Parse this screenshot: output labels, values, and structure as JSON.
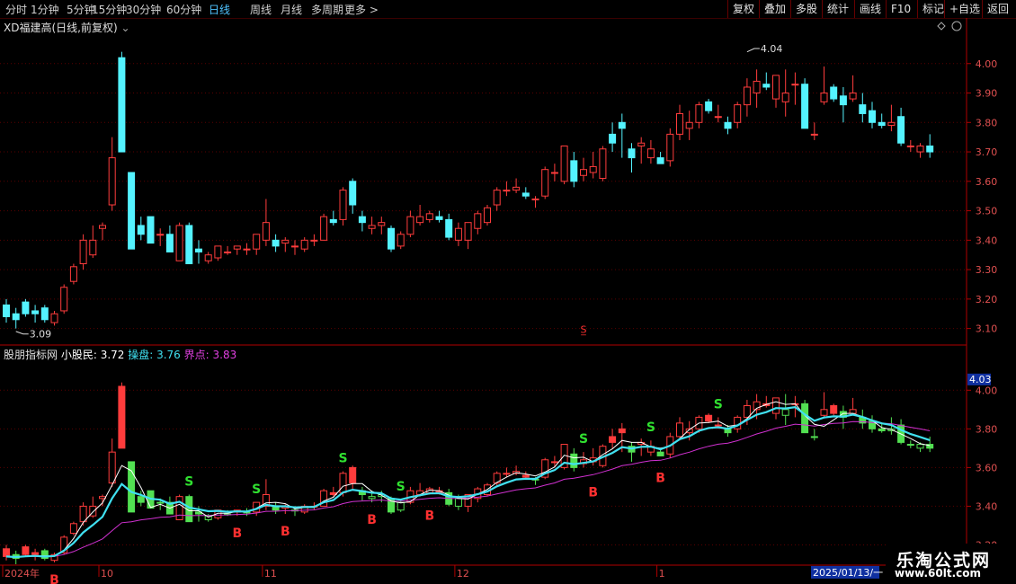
{
  "toolbar": {
    "periods": [
      "分时",
      "1分钟",
      "5分钟",
      "15分钟",
      "30分钟",
      "60分钟",
      "日线",
      "周线",
      "月线",
      "多周期",
      "更多 >"
    ],
    "active_period": "日线",
    "right_buttons": [
      "复权",
      "叠加",
      "多股",
      "统计",
      "画线",
      "F10",
      "标记",
      "+自选",
      "返回"
    ]
  },
  "main_title": "XD福建高(日线,前复权)",
  "indicator": {
    "name": "股朋指标网",
    "lines": [
      {
        "label": "小股民: 3.72",
        "color": "#ffffff"
      },
      {
        "label": "操盘: 3.76",
        "color": "#40e0f0"
      },
      {
        "label": "界点: 3.83",
        "color": "#e040e0"
      }
    ],
    "current_tag": "4.03"
  },
  "x_axis": {
    "labels": [
      {
        "text": "2024年",
        "index": 0
      },
      {
        "text": "10",
        "index": 10
      },
      {
        "text": "11",
        "index": 27
      },
      {
        "text": "12",
        "index": 47
      },
      {
        "text": "1",
        "index": 68
      }
    ],
    "cursor_date": "2025/01/13/一"
  },
  "brand": {
    "title": "乐淘公式网",
    "url": "www.60lt.com"
  },
  "colors": {
    "up": "#ff3c3c",
    "down": "#54f3ff",
    "grid": "#5a0000",
    "axis": "#b00000"
  },
  "chart_data": {
    "type": "candlestick",
    "y_ticks_main": [
      "4.00",
      "3.90",
      "3.80",
      "3.70",
      "3.60",
      "3.50",
      "3.40",
      "3.30",
      "3.20",
      "3.10"
    ],
    "y_ticks_sub": [
      "4.00",
      "3.80",
      "3.60",
      "3.40",
      "3.20"
    ],
    "ylim_main": [
      3.05,
      4.1
    ],
    "ylim_sub": [
      3.1,
      4.15
    ],
    "annotations": [
      {
        "text": "4.04",
        "index": 77,
        "value": 4.04
      },
      {
        "text": "3.09",
        "index": 1,
        "value": 3.09
      },
      {
        "text": "S̲",
        "index": 60,
        "value": 3.085
      }
    ],
    "ohlc": [
      [
        3.18,
        3.2,
        3.12,
        3.14
      ],
      [
        3.15,
        3.17,
        3.1,
        3.13
      ],
      [
        3.19,
        3.2,
        3.14,
        3.15
      ],
      [
        3.16,
        3.18,
        3.12,
        3.15
      ],
      [
        3.17,
        3.18,
        3.12,
        3.13
      ],
      [
        3.12,
        3.16,
        3.11,
        3.15
      ],
      [
        3.16,
        3.25,
        3.15,
        3.24
      ],
      [
        3.26,
        3.32,
        3.25,
        3.31
      ],
      [
        3.32,
        3.42,
        3.3,
        3.4
      ],
      [
        3.35,
        3.45,
        3.34,
        3.4
      ],
      [
        3.44,
        3.46,
        3.4,
        3.45
      ],
      [
        3.52,
        3.75,
        3.5,
        3.68
      ],
      [
        4.02,
        4.04,
        3.75,
        3.7
      ],
      [
        3.63,
        3.63,
        3.37,
        3.37
      ],
      [
        3.45,
        3.48,
        3.4,
        3.42
      ],
      [
        3.48,
        3.48,
        3.4,
        3.39
      ],
      [
        3.42,
        3.44,
        3.38,
        3.42
      ],
      [
        3.42,
        3.45,
        3.36,
        3.36
      ],
      [
        3.33,
        3.46,
        3.33,
        3.45
      ],
      [
        3.45,
        3.46,
        3.32,
        3.32
      ],
      [
        3.37,
        3.4,
        3.32,
        3.36
      ],
      [
        3.33,
        3.36,
        3.32,
        3.35
      ],
      [
        3.34,
        3.38,
        3.33,
        3.38
      ],
      [
        3.36,
        3.38,
        3.35,
        3.36
      ],
      [
        3.37,
        3.38,
        3.35,
        3.38
      ],
      [
        3.37,
        3.39,
        3.35,
        3.37
      ],
      [
        3.37,
        3.42,
        3.35,
        3.42
      ],
      [
        3.4,
        3.54,
        3.38,
        3.46
      ],
      [
        3.4,
        3.42,
        3.36,
        3.38
      ],
      [
        3.39,
        3.41,
        3.36,
        3.4
      ],
      [
        3.38,
        3.4,
        3.35,
        3.38
      ],
      [
        3.37,
        3.41,
        3.36,
        3.4
      ],
      [
        3.4,
        3.42,
        3.38,
        3.4
      ],
      [
        3.4,
        3.49,
        3.4,
        3.48
      ],
      [
        3.47,
        3.5,
        3.45,
        3.46
      ],
      [
        3.47,
        3.58,
        3.45,
        3.57
      ],
      [
        3.6,
        3.61,
        3.49,
        3.52
      ],
      [
        3.48,
        3.5,
        3.43,
        3.46
      ],
      [
        3.44,
        3.48,
        3.42,
        3.45
      ],
      [
        3.45,
        3.48,
        3.42,
        3.46
      ],
      [
        3.44,
        3.45,
        3.36,
        3.37
      ],
      [
        3.38,
        3.43,
        3.37,
        3.42
      ],
      [
        3.42,
        3.5,
        3.41,
        3.48
      ],
      [
        3.46,
        3.52,
        3.45,
        3.48
      ],
      [
        3.47,
        3.5,
        3.46,
        3.49
      ],
      [
        3.48,
        3.5,
        3.46,
        3.47
      ],
      [
        3.47,
        3.49,
        3.4,
        3.41
      ],
      [
        3.4,
        3.46,
        3.38,
        3.44
      ],
      [
        3.4,
        3.46,
        3.37,
        3.46
      ],
      [
        3.44,
        3.5,
        3.42,
        3.49
      ],
      [
        3.46,
        3.52,
        3.45,
        3.51
      ],
      [
        3.52,
        3.58,
        3.5,
        3.57
      ],
      [
        3.57,
        3.6,
        3.55,
        3.57
      ],
      [
        3.57,
        3.61,
        3.56,
        3.58
      ],
      [
        3.56,
        3.58,
        3.54,
        3.55
      ],
      [
        3.54,
        3.55,
        3.51,
        3.54
      ],
      [
        3.55,
        3.65,
        3.54,
        3.64
      ],
      [
        3.63,
        3.66,
        3.6,
        3.63
      ],
      [
        3.6,
        3.72,
        3.59,
        3.72
      ],
      [
        3.67,
        3.7,
        3.58,
        3.6
      ],
      [
        3.62,
        3.68,
        3.6,
        3.64
      ],
      [
        3.63,
        3.7,
        3.61,
        3.65
      ],
      [
        3.61,
        3.72,
        3.6,
        3.71
      ],
      [
        3.76,
        3.8,
        3.7,
        3.73
      ],
      [
        3.8,
        3.83,
        3.68,
        3.78
      ],
      [
        3.71,
        3.73,
        3.63,
        3.68
      ],
      [
        3.72,
        3.75,
        3.66,
        3.73
      ],
      [
        3.68,
        3.74,
        3.66,
        3.71
      ],
      [
        3.68,
        3.7,
        3.66,
        3.66
      ],
      [
        3.67,
        3.78,
        3.65,
        3.76
      ],
      [
        3.76,
        3.86,
        3.74,
        3.83
      ],
      [
        3.78,
        3.84,
        3.74,
        3.8
      ],
      [
        3.8,
        3.87,
        3.78,
        3.86
      ],
      [
        3.87,
        3.88,
        3.83,
        3.84
      ],
      [
        3.82,
        3.86,
        3.8,
        3.82
      ],
      [
        3.8,
        3.82,
        3.76,
        3.78
      ],
      [
        3.8,
        3.87,
        3.78,
        3.86
      ],
      [
        3.86,
        3.95,
        3.82,
        3.92
      ],
      [
        3.9,
        3.98,
        3.85,
        3.94
      ],
      [
        3.93,
        3.97,
        3.91,
        3.92
      ],
      [
        3.88,
        3.96,
        3.85,
        3.96
      ],
      [
        3.87,
        3.98,
        3.82,
        3.9
      ],
      [
        3.93,
        3.97,
        3.86,
        3.93
      ],
      [
        3.93,
        3.95,
        3.78,
        3.78
      ],
      [
        3.76,
        3.8,
        3.74,
        3.76
      ],
      [
        3.87,
        3.99,
        3.86,
        3.9
      ],
      [
        3.92,
        3.93,
        3.87,
        3.88
      ],
      [
        3.89,
        3.92,
        3.8,
        3.86
      ],
      [
        3.88,
        3.96,
        3.87,
        3.9
      ],
      [
        3.86,
        3.9,
        3.8,
        3.83
      ],
      [
        3.84,
        3.87,
        3.78,
        3.8
      ],
      [
        3.8,
        3.83,
        3.78,
        3.79
      ],
      [
        3.79,
        3.86,
        3.77,
        3.8
      ],
      [
        3.82,
        3.85,
        3.72,
        3.73
      ],
      [
        3.72,
        3.74,
        3.7,
        3.72
      ],
      [
        3.7,
        3.73,
        3.68,
        3.72
      ],
      [
        3.72,
        3.76,
        3.68,
        3.7
      ]
    ],
    "signals": [
      {
        "type": "B",
        "index": 5
      },
      {
        "type": "S",
        "index": 19
      },
      {
        "type": "B",
        "index": 24
      },
      {
        "type": "S",
        "index": 26
      },
      {
        "type": "B",
        "index": 29
      },
      {
        "type": "S",
        "index": 35
      },
      {
        "type": "B",
        "index": 38
      },
      {
        "type": "S",
        "index": 41
      },
      {
        "type": "B",
        "index": 44
      },
      {
        "type": "S",
        "index": 60
      },
      {
        "type": "B",
        "index": 61
      },
      {
        "type": "S",
        "index": 67
      },
      {
        "type": "B",
        "index": 68
      },
      {
        "type": "S",
        "index": 74
      }
    ]
  }
}
